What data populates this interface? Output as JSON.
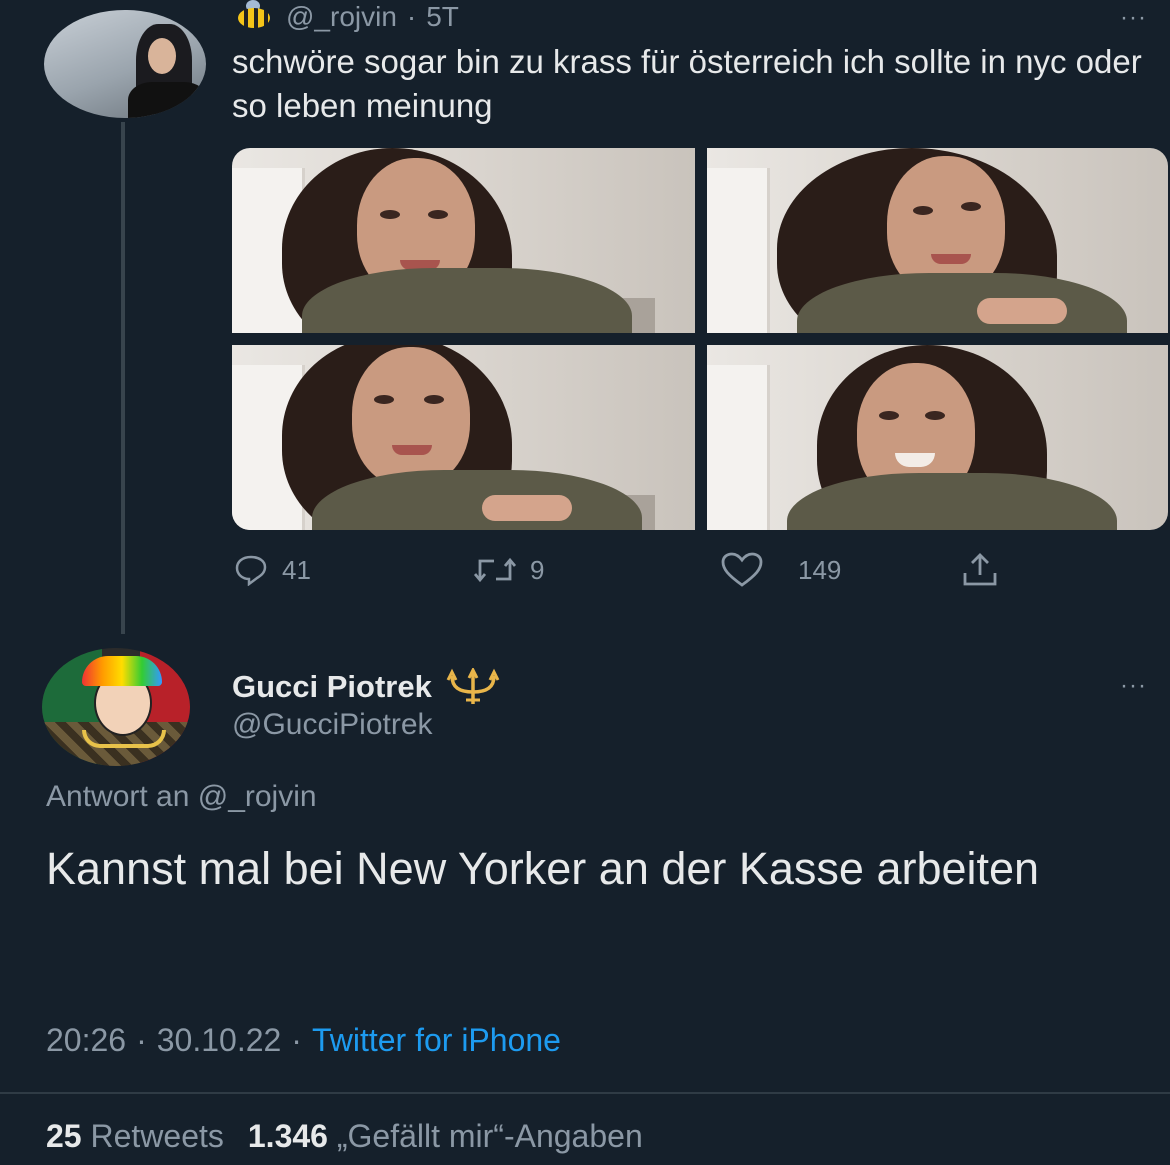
{
  "original_tweet": {
    "handle": "@_rojvin",
    "separator": "·",
    "time_ago": "5T",
    "more": "···",
    "text": "schwöre sogar bin zu krass für österreich ich sollte in nyc oder so leben meinung",
    "icons": {
      "badge": "bee-icon",
      "avatar": "avatar"
    },
    "photos": [
      "photo-1",
      "photo-2",
      "photo-3",
      "photo-4"
    ],
    "actions": {
      "replies": "41",
      "retweets": "9",
      "likes": "149"
    }
  },
  "reply_tweet": {
    "display_name": "Gucci Piotrek",
    "name_badge": "trident-icon",
    "handle": "@GucciPiotrek",
    "more": "···",
    "replying_to": "Antwort an @_rojvin",
    "text": "Kannst mal bei New Yorker an der Kasse arbeiten",
    "time": "20:26",
    "separator": "·",
    "date": "30.10.22",
    "source": "Twitter for iPhone",
    "stats": {
      "retweets_count": "25",
      "retweets_label": "Retweets",
      "likes_count": "1.346",
      "likes_label": "„Gefällt mir“-Angaben"
    }
  },
  "colors": {
    "background": "#15202b",
    "text_primary": "#e7e9ea",
    "text_secondary": "#8b98a5",
    "link": "#1d9bf0",
    "trident": "#e8b54a"
  }
}
